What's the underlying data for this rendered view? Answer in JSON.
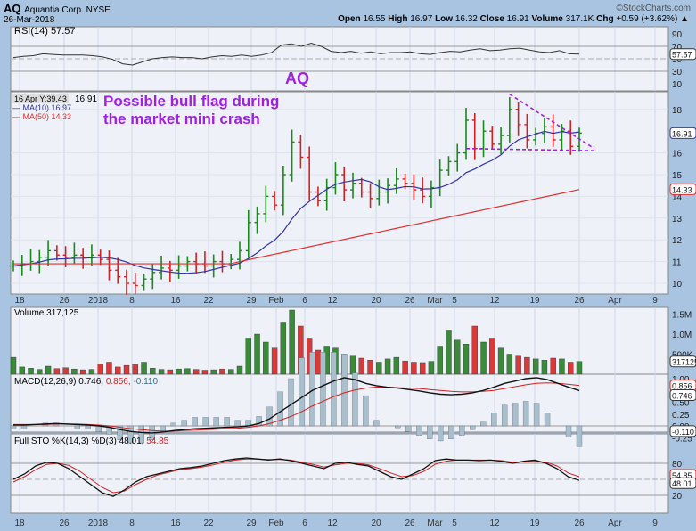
{
  "header": {
    "symbol": "AQ",
    "company": "Aquantia Corp. NYSE",
    "date": "26-Mar-2018",
    "brand": "©StockCharts.com",
    "open_label": "Open",
    "open": "16.55",
    "high_label": "High",
    "high": "16.97",
    "low_label": "Low",
    "low": "16.32",
    "close_label": "Close",
    "close": "16.91",
    "volume_label": "Volume",
    "volume": "317.1K",
    "chg_label": "Chg",
    "chg": "+0.59 (+3.62%)"
  },
  "annotations": {
    "ticker": "AQ",
    "note_line1": "Possible bull flag during",
    "note_line2": "the market mini crash",
    "cursor": "16 Apr Y:39.43",
    "last": "16.91"
  },
  "legends": {
    "rsi": "RSI(14) 57.57",
    "ma10": "MA(10) 16.97",
    "ma50": "MA(50) 14.33",
    "volume": "Volume 317,125",
    "macd_a": "MACD(12,26,9) 0.746,",
    "macd_b": "0.856,",
    "macd_c": "-0.110",
    "sto_a": "Full STO %K(14,3) %D(3) 48.01,",
    "sto_b": "54.85"
  },
  "colors": {
    "up": "#1a8a1a",
    "down": "#d42020",
    "ma10": "#3333aa",
    "ma50": "#e03030",
    "annot": "#a020e0"
  },
  "chart_data": {
    "type": "line",
    "title": "AQ Aquantia Corp. NYSE daily",
    "x_labels": [
      "18",
      "26",
      "2018",
      "8",
      "16",
      "22",
      "29",
      "Feb",
      "6",
      "12",
      "20",
      "26",
      "Mar",
      "5",
      "12",
      "19",
      "26",
      "Apr",
      "9"
    ],
    "closes": [
      10.8,
      10.9,
      11.0,
      11.2,
      11.5,
      11.3,
      11.2,
      11.3,
      11.2,
      11.3,
      11.1,
      10.6,
      10.3,
      10.0,
      9.9,
      10.2,
      10.5,
      10.7,
      10.6,
      10.8,
      11.0,
      10.9,
      10.8,
      11.0,
      10.9,
      11.1,
      11.5,
      12.8,
      13.2,
      14.0,
      13.6,
      15.0,
      16.5,
      15.8,
      14.2,
      13.8,
      14.4,
      15.0,
      14.3,
      14.6,
      14.2,
      13.9,
      14.2,
      14.5,
      14.8,
      14.6,
      14.3,
      14.0,
      14.4,
      15.2,
      15.6,
      16.0,
      17.5,
      16.2,
      17.0,
      16.4,
      16.8,
      18.0,
      17.3,
      16.6,
      16.9,
      17.2,
      16.6,
      17.0,
      16.3,
      16.91
    ],
    "volume_k": [
      420,
      180,
      150,
      120,
      200,
      140,
      160,
      130,
      110,
      120,
      260,
      300,
      180,
      220,
      250,
      300,
      150,
      120,
      110,
      130,
      140,
      120,
      100,
      110,
      130,
      120,
      200,
      900,
      1000,
      800,
      650,
      1300,
      1600,
      1200,
      900,
      600,
      700,
      650,
      500,
      450,
      400,
      350,
      300,
      380,
      420,
      330,
      300,
      290,
      320,
      700,
      1100,
      850,
      750,
      1200,
      800,
      900,
      650,
      500,
      450,
      420,
      380,
      350,
      400,
      380,
      300,
      317
    ],
    "rsi": [
      52,
      54,
      55,
      58,
      57,
      56,
      56,
      56,
      55,
      53,
      49,
      42,
      40,
      45,
      50,
      52,
      53,
      52,
      52,
      50,
      53,
      55,
      54,
      56,
      54,
      56,
      60,
      72,
      74,
      70,
      75,
      70,
      62,
      60,
      62,
      59,
      61,
      58,
      60,
      60,
      61,
      58,
      57,
      60,
      62,
      61,
      64,
      66,
      63,
      64,
      66,
      67,
      64,
      61,
      60,
      63,
      58,
      57.57
    ],
    "macd": [
      0.02,
      0.02,
      0.03,
      0.04,
      0.05,
      0.04,
      0.03,
      0.02,
      0.0,
      -0.03,
      -0.08,
      -0.12,
      -0.14,
      -0.15,
      -0.13,
      -0.1,
      -0.08,
      -0.06,
      -0.05,
      -0.04,
      -0.03,
      -0.02,
      0.0,
      0.05,
      0.15,
      0.3,
      0.45,
      0.6,
      0.75,
      0.85,
      0.95,
      1.02,
      0.98,
      0.9,
      0.85,
      0.82,
      0.8,
      0.77,
      0.74,
      0.7,
      0.67,
      0.66,
      0.67,
      0.7,
      0.75,
      0.82,
      0.9,
      0.95,
      1.0,
      1.02,
      0.98,
      0.9,
      0.82,
      0.746
    ],
    "macd_signal": [
      0.03,
      0.03,
      0.03,
      0.03,
      0.04,
      0.04,
      0.04,
      0.03,
      0.02,
      0.0,
      -0.03,
      -0.06,
      -0.08,
      -0.1,
      -0.11,
      -0.11,
      -0.1,
      -0.09,
      -0.08,
      -0.07,
      -0.06,
      -0.05,
      -0.03,
      0.0,
      0.05,
      0.12,
      0.2,
      0.3,
      0.42,
      0.52,
      0.62,
      0.7,
      0.76,
      0.8,
      0.82,
      0.82,
      0.81,
      0.8,
      0.79,
      0.77,
      0.75,
      0.73,
      0.72,
      0.72,
      0.73,
      0.75,
      0.79,
      0.83,
      0.87,
      0.9,
      0.91,
      0.9,
      0.88,
      0.856
    ],
    "sto_k": [
      50,
      60,
      75,
      82,
      80,
      70,
      55,
      40,
      25,
      18,
      30,
      45,
      55,
      60,
      65,
      70,
      72,
      75,
      80,
      85,
      88,
      90,
      88,
      86,
      88,
      85,
      80,
      75,
      70,
      80,
      82,
      78,
      75,
      65,
      55,
      50,
      60,
      70,
      85,
      88,
      86,
      86,
      85,
      86,
      84,
      80,
      84,
      86,
      80,
      70,
      55,
      48.01
    ],
    "sto_d": [
      45,
      55,
      68,
      78,
      80,
      76,
      65,
      50,
      35,
      25,
      28,
      40,
      50,
      58,
      63,
      68,
      70,
      73,
      77,
      82,
      86,
      88,
      88,
      87,
      87,
      86,
      82,
      78,
      73,
      77,
      80,
      80,
      77,
      70,
      62,
      55,
      57,
      65,
      78,
      84,
      86,
      86,
      86,
      86,
      85,
      82,
      83,
      84,
      82,
      75,
      62,
      54.85
    ],
    "y_ticks_price": [
      "18",
      "16",
      "15",
      "14",
      "13",
      "12",
      "11",
      "10"
    ],
    "y_ticks_rsi": [
      "90",
      "70",
      "50",
      "30",
      "10"
    ],
    "y_ticks_volume": [
      "1.5M",
      "1.0M",
      "500K"
    ],
    "y_ticks_macd": [
      "1.00",
      "0.75",
      "0.50",
      "0.25",
      "0.00",
      "-0.25"
    ],
    "y_ticks_sto": [
      "80",
      "50",
      "20"
    ],
    "tags": {
      "price": "16.91",
      "ma50": "14.33",
      "rsi": "57.57",
      "volume": "317125",
      "macd": "0.746",
      "signal": "0.856",
      "hist": "-0.110",
      "k": "48.01",
      "d": "54.85"
    }
  }
}
